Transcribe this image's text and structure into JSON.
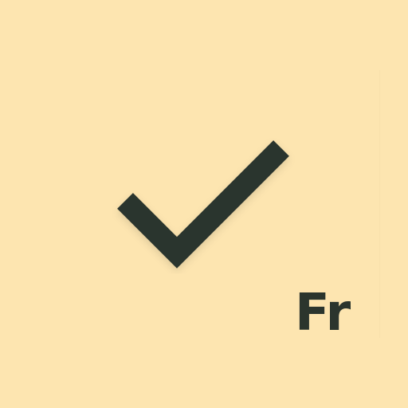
{
  "tile": {
    "background_color": "#fde5b0",
    "icon": "check-icon",
    "icon_color": "#2b352d",
    "language_label": "Fr"
  }
}
